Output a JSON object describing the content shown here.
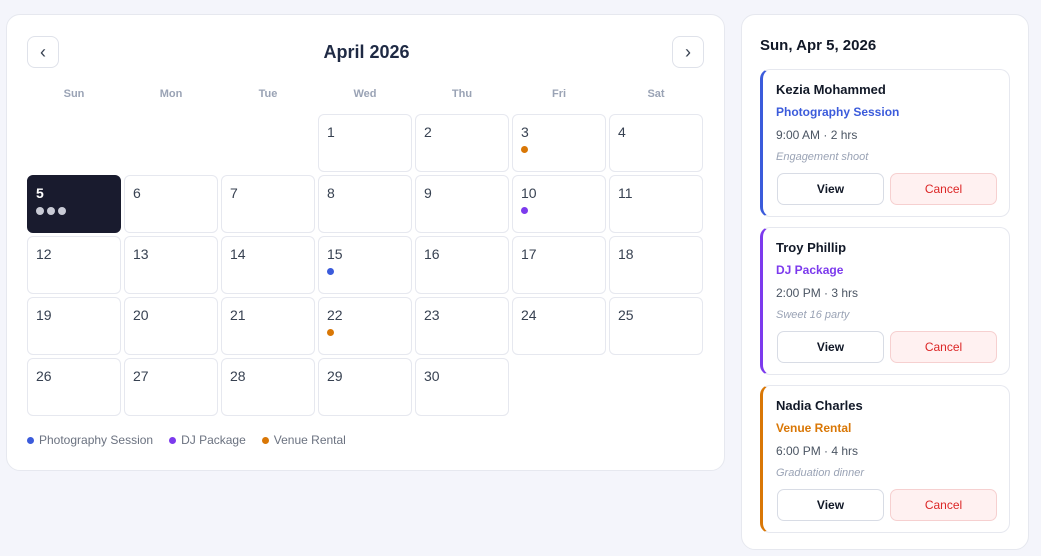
{
  "calendar": {
    "month_title": "April 2026",
    "prev_label": "‹",
    "next_label": "›",
    "weekdays": [
      "Sun",
      "Mon",
      "Tue",
      "Wed",
      "Thu",
      "Fri",
      "Sat"
    ],
    "leading_blanks": 3,
    "days": [
      {
        "num": "1"
      },
      {
        "num": "2"
      },
      {
        "num": "3",
        "dots": [
          "venue"
        ]
      },
      {
        "num": "4"
      },
      {
        "num": "5",
        "selected": true,
        "dots": [
          "photo",
          "dj",
          "venue"
        ]
      },
      {
        "num": "6"
      },
      {
        "num": "7"
      },
      {
        "num": "8"
      },
      {
        "num": "9"
      },
      {
        "num": "10",
        "dots": [
          "dj"
        ]
      },
      {
        "num": "11"
      },
      {
        "num": "12"
      },
      {
        "num": "13"
      },
      {
        "num": "14"
      },
      {
        "num": "15",
        "dots": [
          "photo"
        ]
      },
      {
        "num": "16"
      },
      {
        "num": "17"
      },
      {
        "num": "18"
      },
      {
        "num": "19"
      },
      {
        "num": "20"
      },
      {
        "num": "21"
      },
      {
        "num": "22",
        "dots": [
          "venue"
        ]
      },
      {
        "num": "23"
      },
      {
        "num": "24"
      },
      {
        "num": "25"
      },
      {
        "num": "26"
      },
      {
        "num": "27"
      },
      {
        "num": "28"
      },
      {
        "num": "29"
      },
      {
        "num": "30"
      }
    ]
  },
  "colors": {
    "photo": "#3b5bdb",
    "dj": "#7c3aed",
    "venue": "#d97706"
  },
  "legend": [
    {
      "key": "photo",
      "label": "Photography Session"
    },
    {
      "key": "dj",
      "label": "DJ Package"
    },
    {
      "key": "venue",
      "label": "Venue Rental"
    }
  ],
  "side_panel": {
    "title": "Sun, Apr 5, 2026",
    "view_label": "View",
    "cancel_label": "Cancel",
    "bookings": [
      {
        "name": "Kezia Mohammed",
        "service": "Photography Session",
        "type": "photo",
        "time": "9:00 AM · 2 hrs",
        "note": "Engagement shoot"
      },
      {
        "name": "Troy Phillip",
        "service": "DJ Package",
        "type": "dj",
        "time": "2:00 PM · 3 hrs",
        "note": "Sweet 16 party"
      },
      {
        "name": "Nadia Charles",
        "service": "Venue Rental",
        "type": "venue",
        "time": "6:00 PM · 4 hrs",
        "note": "Graduation dinner"
      }
    ]
  }
}
